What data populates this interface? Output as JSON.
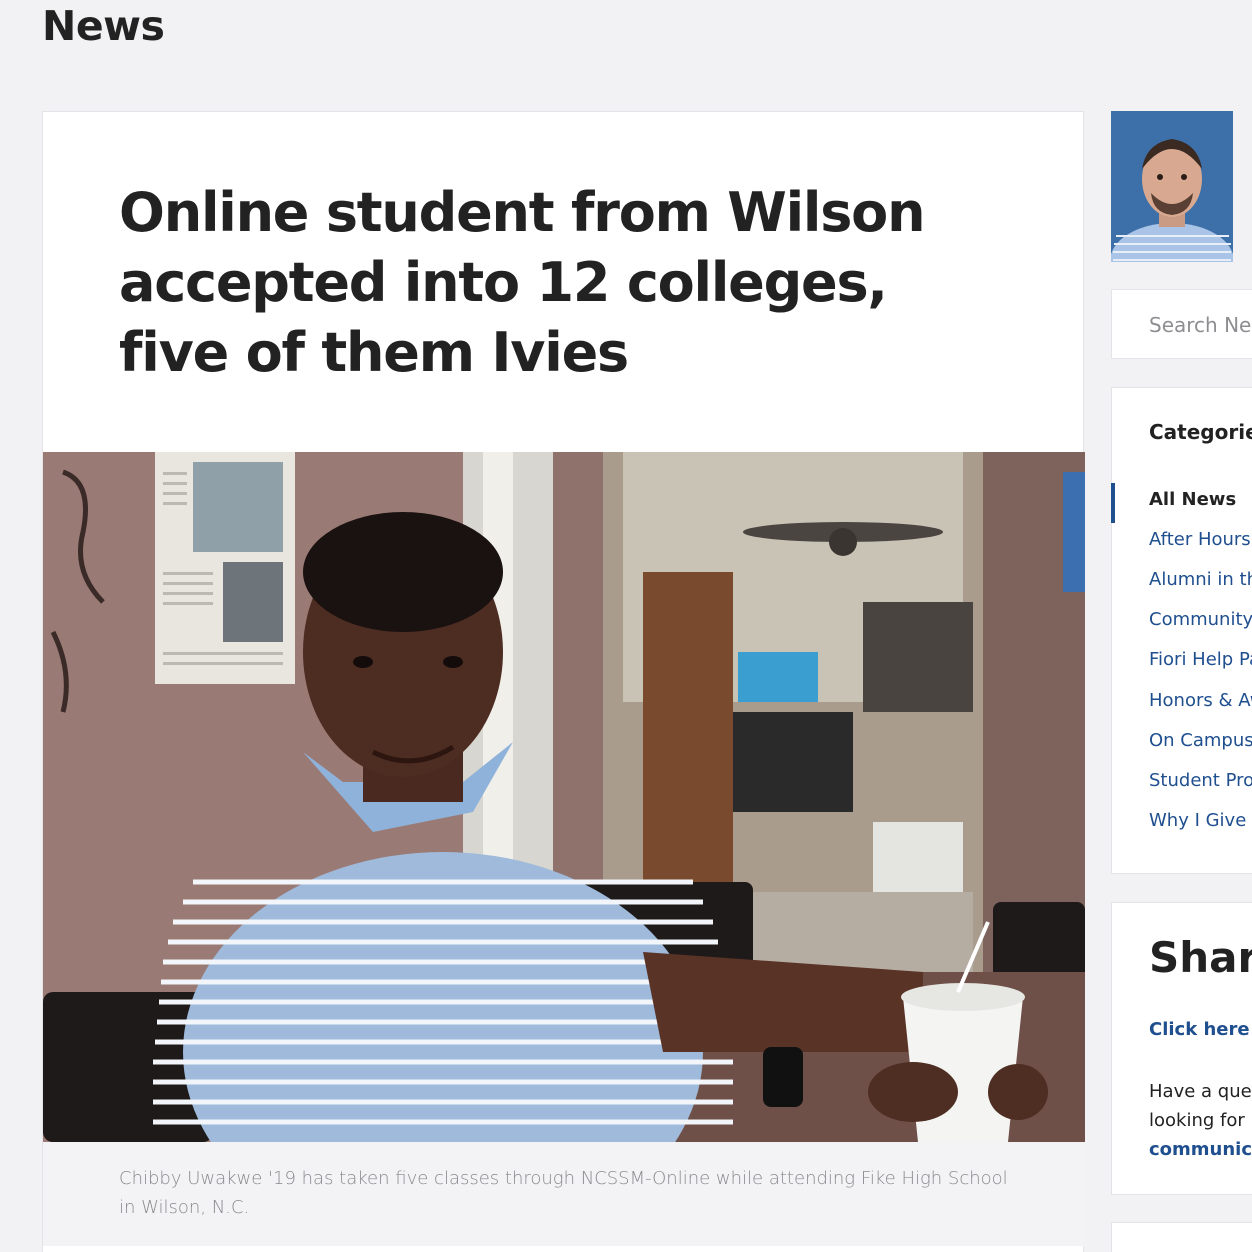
{
  "page": {
    "heading": "News"
  },
  "article": {
    "title": "Online student from Wilson accepted into 12 colleges, five of them Ivies",
    "image_alt": "Chibby Uwakwe seated at a cafe table",
    "caption": "Chibby Uwakwe '19 has taken five classes through NCSSM-Online while attending Fike High School in Wilson, N.C."
  },
  "sidebar": {
    "avatar_alt": "Staff portrait",
    "search": {
      "placeholder": "Search News"
    },
    "categories": {
      "title": "Categories",
      "items": [
        {
          "label": "All News",
          "active": true
        },
        {
          "label": "After Hours",
          "active": false
        },
        {
          "label": "Alumni in the News",
          "active": false
        },
        {
          "label": "Community",
          "active": false
        },
        {
          "label": "Fiori Help Page",
          "active": false
        },
        {
          "label": "Honors & Awards",
          "active": false
        },
        {
          "label": "On Campus",
          "active": false
        },
        {
          "label": "Student Profiles",
          "active": false
        },
        {
          "label": "Why I Give",
          "active": false
        }
      ]
    },
    "share": {
      "title": "Share",
      "link_label": "Click here to",
      "body_line1": "Have a question",
      "body_line2": "looking for",
      "body_link": "communications"
    }
  },
  "colors": {
    "link": "#1f4f8f",
    "background": "#f2f2f4",
    "card": "#ffffff"
  }
}
